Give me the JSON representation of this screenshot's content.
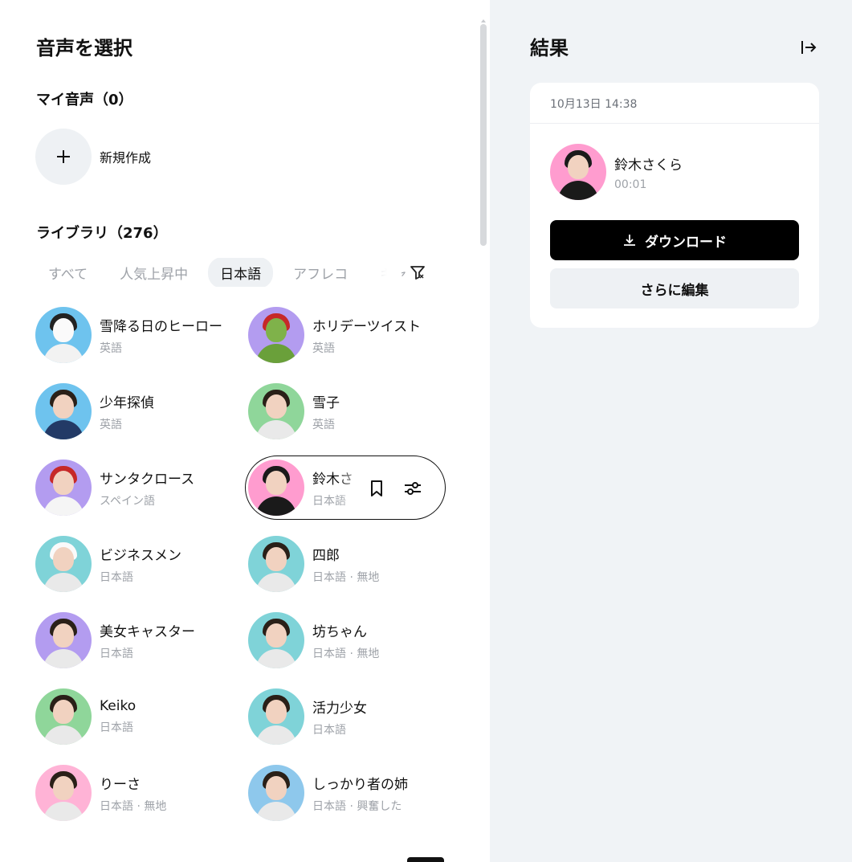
{
  "left_panel": {
    "title": "音声を選択",
    "my_voices_heading": "マイ音声（0）",
    "new_voice_label": "新規作成",
    "library_heading": "ライブラリ（276）",
    "tabs": [
      {
        "label": "すべて",
        "active": false
      },
      {
        "label": "人気上昇中",
        "active": false
      },
      {
        "label": "日本語",
        "active": true
      },
      {
        "label": "アフレコ",
        "active": false
      },
      {
        "label": "キャ",
        "active": false
      }
    ],
    "voices": [
      {
        "name": "雪降る日のヒーロー",
        "sub": "英語",
        "bg": "#6ec3ee",
        "icon": "snowman-avatar"
      },
      {
        "name": "ホリデーツイスト",
        "sub": "英語",
        "bg": "#b39cf0",
        "icon": "grinch-avatar"
      },
      {
        "name": "少年探偵",
        "sub": "英語",
        "bg": "#6ec3ee",
        "icon": "boy-detective-avatar"
      },
      {
        "name": "雪子",
        "sub": "英語",
        "bg": "#8fd69a",
        "icon": "woman-avatar"
      },
      {
        "name": "サンタクロース",
        "sub": "スペイン語",
        "bg": "#b39cf0",
        "icon": "santa-avatar"
      },
      {
        "name": "鈴木さくら",
        "sub": "日本語",
        "bg": "#ff9ccf",
        "icon": "woman-avatar"
      },
      {
        "name": "ビジネスメン",
        "sub": "日本語",
        "bg": "#7fd3d8",
        "icon": "chef-avatar"
      },
      {
        "name": "四郎",
        "sub": "日本語 · 無地",
        "bg": "#7fd3d8",
        "icon": "boy-avatar"
      },
      {
        "name": "美女キャスター",
        "sub": "日本語",
        "bg": "#b39cf0",
        "icon": "woman-avatar"
      },
      {
        "name": "坊ちゃん",
        "sub": "日本語 · 無地",
        "bg": "#7fd3d8",
        "icon": "girl-avatar"
      },
      {
        "name": "Keiko",
        "sub": "日本語",
        "bg": "#8fd69a",
        "icon": "woman-avatar"
      },
      {
        "name": "活力少女",
        "sub": "日本語",
        "bg": "#7fd3d8",
        "icon": "girl-avatar"
      },
      {
        "name": "りーさ",
        "sub": "日本語 · 無地",
        "bg": "#ffb3d6",
        "icon": "man-avatar"
      },
      {
        "name": "しっかり者の姉",
        "sub": "日本語 · 興奮した",
        "bg": "#8ec8ec",
        "icon": "doll-avatar"
      }
    ],
    "selected_voice_name_visible": "鈴木さ",
    "selected_voice_sub_visible": "日本語"
  },
  "right_panel": {
    "title": "結果",
    "result": {
      "date": "10月13日 14:38",
      "voice_name": "鈴木さくら",
      "duration": "00:01",
      "download_label": "ダウンロード",
      "edit_label": "さらに編集"
    }
  },
  "colors": {
    "accent": "#000000",
    "panel_bg": "#f0f3f6",
    "muted_text": "#9ea2a8"
  }
}
